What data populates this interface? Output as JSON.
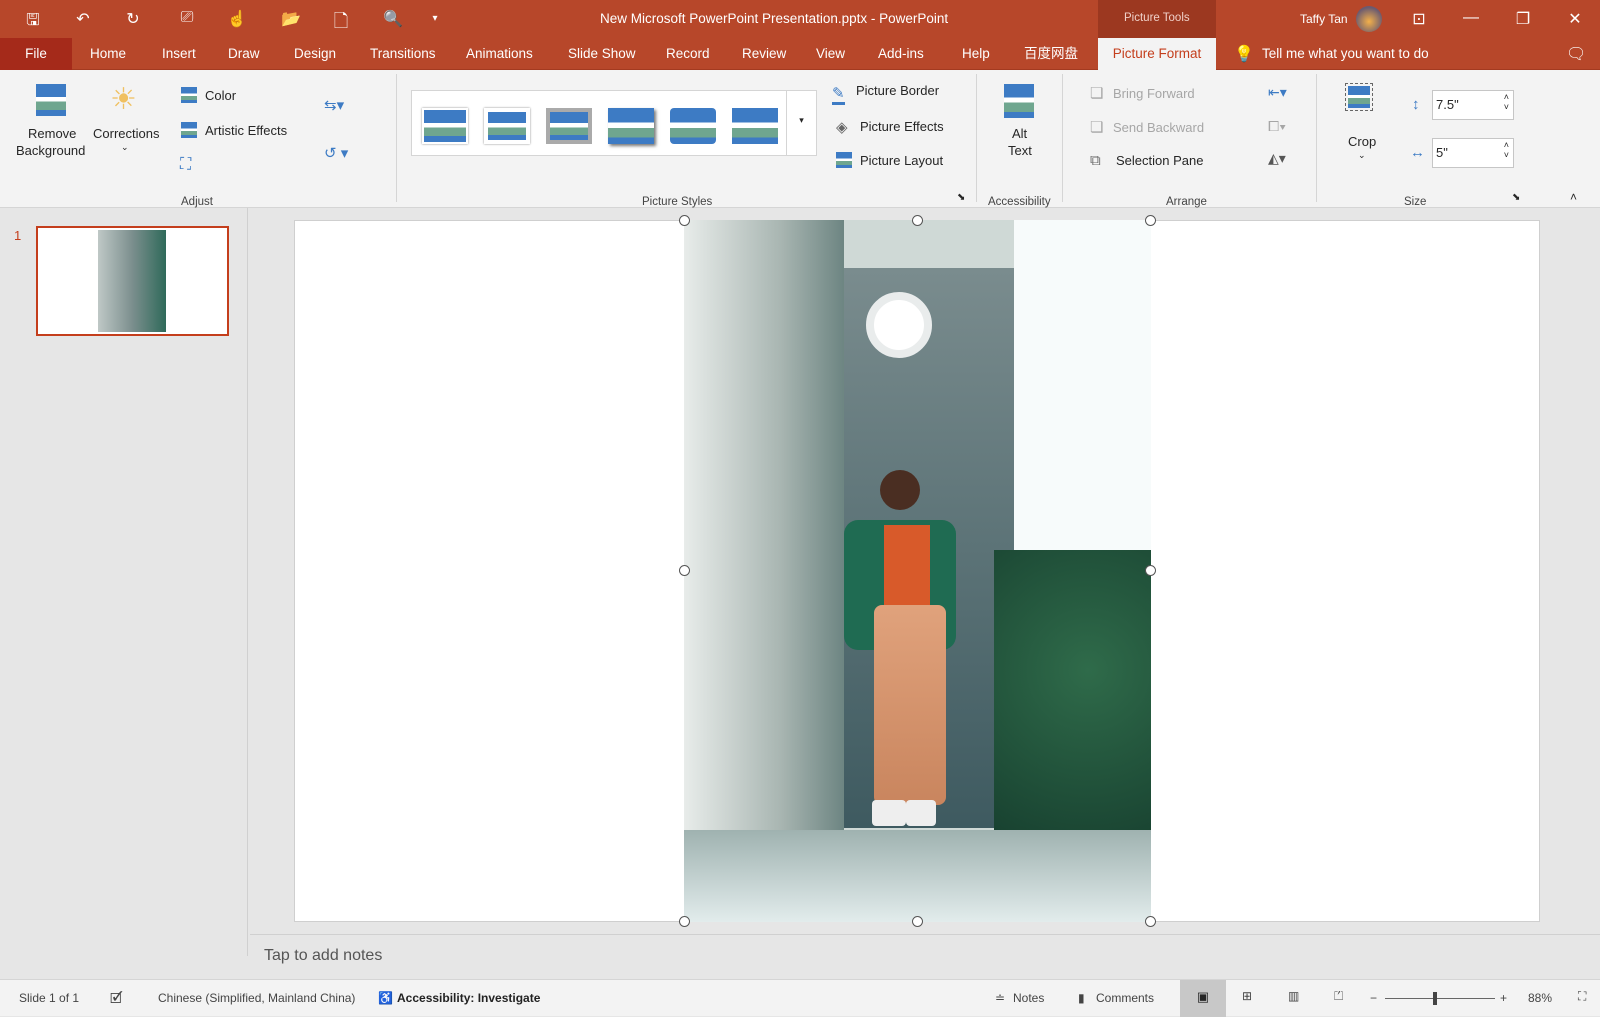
{
  "window": {
    "title": "New Microsoft PowerPoint Presentation.pptx  -  PowerPoint",
    "context_group": "Picture Tools",
    "user": "Taffy Tan",
    "accent": "#b7472a"
  },
  "quick_access": [
    "save-icon",
    "undo-icon",
    "redo-icon",
    "present-icon",
    "touch-mode-icon",
    "open-icon",
    "new-icon",
    "print-preview-icon",
    "customize-icon"
  ],
  "tabs": [
    {
      "label": "File"
    },
    {
      "label": "Home"
    },
    {
      "label": "Insert"
    },
    {
      "label": "Draw"
    },
    {
      "label": "Design"
    },
    {
      "label": "Transitions"
    },
    {
      "label": "Animations"
    },
    {
      "label": "Slide Show"
    },
    {
      "label": "Record"
    },
    {
      "label": "Review"
    },
    {
      "label": "View"
    },
    {
      "label": "Add-ins"
    },
    {
      "label": "Help"
    },
    {
      "label": "百度网盘"
    },
    {
      "label": "Picture Format",
      "active": true
    }
  ],
  "tell_me": "Tell me what you want to do",
  "ribbon": {
    "adjust": {
      "label": "Adjust",
      "remove_bg_1": "Remove",
      "remove_bg_2": "Background",
      "corrections": "Corrections",
      "color": "Color",
      "artistic": "Artistic Effects"
    },
    "styles": {
      "label": "Picture Styles",
      "border": "Picture Border",
      "effects": "Picture Effects",
      "layout": "Picture Layout"
    },
    "accessibility": {
      "label": "Accessibility",
      "alt1": "Alt",
      "alt2": "Text"
    },
    "arrange": {
      "label": "Arrange",
      "bring": "Bring Forward",
      "send": "Send Backward",
      "selection": "Selection Pane"
    },
    "size": {
      "label": "Size",
      "crop": "Crop",
      "height": "7.5\"",
      "width": "5\""
    }
  },
  "thumbs": [
    {
      "number": "1"
    }
  ],
  "notes_placeholder": "Tap to add notes",
  "status": {
    "slide": "Slide 1 of 1",
    "language": "Chinese (Simplified, Mainland China)",
    "accessibility": "Accessibility: Investigate",
    "notes": "Notes",
    "comments": "Comments",
    "zoom": "88%",
    "zoom_level": 88
  }
}
